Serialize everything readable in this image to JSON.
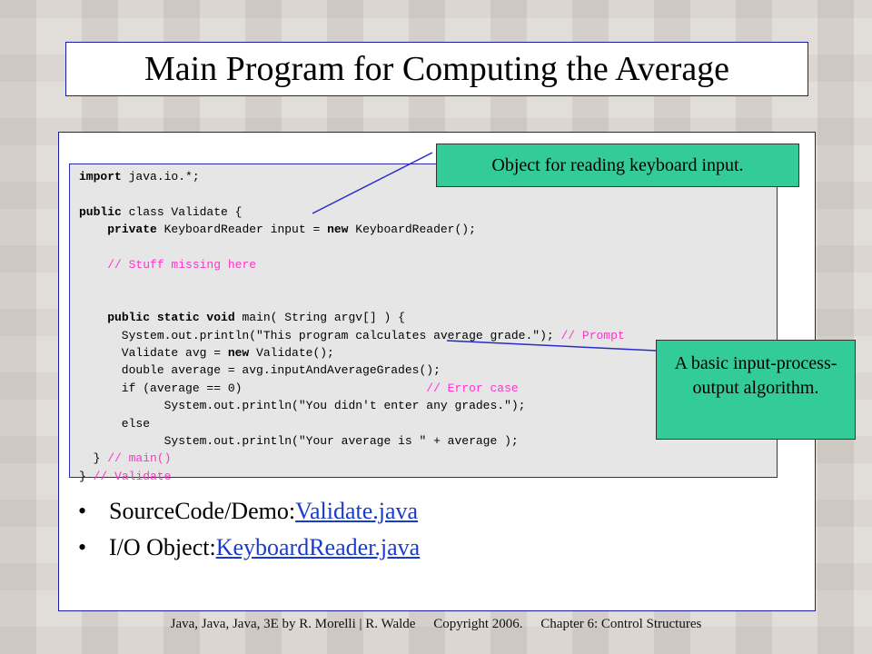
{
  "slide": {
    "title": "Main Program for Computing the Average",
    "code_lines": [
      {
        "parts": [
          {
            "t": "import",
            "k": "kw"
          },
          {
            "t": " java.io.*;",
            "k": ""
          }
        ]
      },
      {
        "parts": []
      },
      {
        "parts": [
          {
            "t": "public",
            "k": "kw"
          },
          {
            "t": " class Validate {",
            "k": ""
          }
        ]
      },
      {
        "parts": [
          {
            "t": "    ",
            "k": ""
          },
          {
            "t": "private",
            "k": "kw"
          },
          {
            "t": " KeyboardReader input = ",
            "k": ""
          },
          {
            "t": "new",
            "k": "kw"
          },
          {
            "t": " KeyboardReader();",
            "k": ""
          }
        ]
      },
      {
        "parts": []
      },
      {
        "parts": [
          {
            "t": "    ",
            "k": ""
          },
          {
            "t": "// Stuff missing here",
            "k": "cm"
          }
        ]
      },
      {
        "parts": []
      },
      {
        "parts": []
      },
      {
        "parts": [
          {
            "t": "    ",
            "k": ""
          },
          {
            "t": "public static void",
            "k": "kw"
          },
          {
            "t": " main( String argv[] ) {",
            "k": ""
          }
        ]
      },
      {
        "parts": [
          {
            "t": "      System.out.println(\"This program calculates average grade.\"); ",
            "k": ""
          },
          {
            "t": "// Prompt",
            "k": "cm"
          }
        ]
      },
      {
        "parts": [
          {
            "t": "      Validate avg = ",
            "k": ""
          },
          {
            "t": "new",
            "k": "kw"
          },
          {
            "t": " Validate();",
            "k": ""
          }
        ]
      },
      {
        "parts": [
          {
            "t": "      double average = avg.inputAndAverageGrades();",
            "k": ""
          }
        ]
      },
      {
        "parts": [
          {
            "t": "      if (average == 0)                          ",
            "k": ""
          },
          {
            "t": "// Error case",
            "k": "cm"
          }
        ]
      },
      {
        "parts": [
          {
            "t": "            System.out.println(\"You didn't enter any grades.\");",
            "k": ""
          }
        ]
      },
      {
        "parts": [
          {
            "t": "      else",
            "k": ""
          }
        ]
      },
      {
        "parts": [
          {
            "t": "            System.out.println(\"Your average is \" + average );",
            "k": ""
          }
        ]
      },
      {
        "parts": [
          {
            "t": "  } ",
            "k": ""
          },
          {
            "t": "// main()",
            "k": "cm"
          }
        ]
      },
      {
        "parts": [
          {
            "t": "} ",
            "k": ""
          },
          {
            "t": "// Validate",
            "k": "cm"
          }
        ]
      }
    ],
    "callout_top": "Object for reading keyboard input.",
    "callout_right": "A basic input-process-output algorithm.",
    "bullets": [
      {
        "label": "SourceCode/Demo: ",
        "link": "Validate.java"
      },
      {
        "label": "I/O Object: ",
        "link": "KeyboardReader.java"
      }
    ],
    "footer": {
      "book": "Java, Java, Java, 3E by R. Morelli | R. Walde",
      "copyright": "Copyright 2006.",
      "chapter": "Chapter 6: Control Structures"
    },
    "bullet_char": "•"
  }
}
